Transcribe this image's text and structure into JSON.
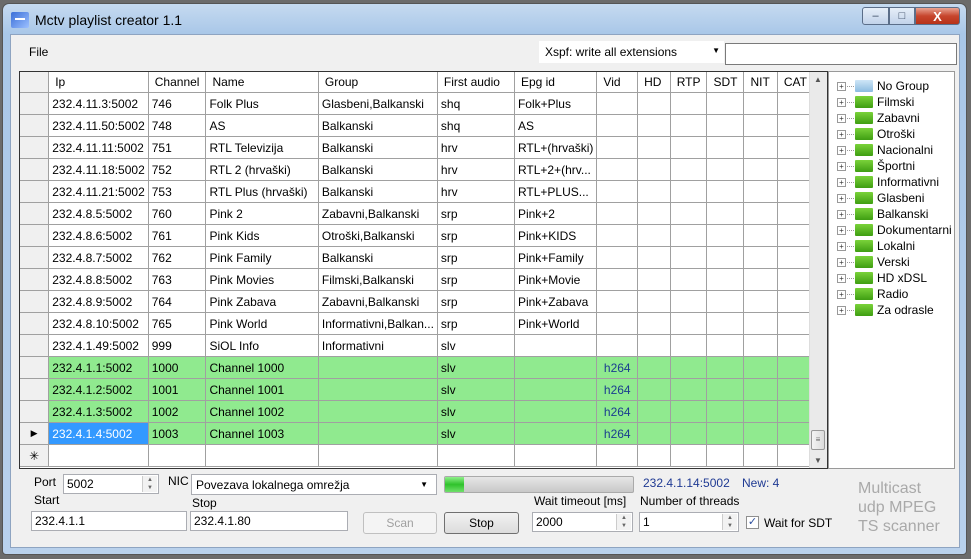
{
  "window": {
    "title": "Mctv playlist creator 1.1",
    "buttons": {
      "minimize": "–",
      "maximize": "□",
      "close": "X"
    }
  },
  "menu": {
    "file": "File"
  },
  "toolbar": {
    "xspf_mode": "Xspf: write all extensions",
    "search_value": ""
  },
  "grid": {
    "columns": [
      "Ip",
      "Channel",
      "Name",
      "Group",
      "First audio",
      "Epg id",
      "Vid",
      "HD",
      "RTP",
      "SDT",
      "NIT",
      "CAT"
    ],
    "rows": [
      {
        "ip": "232.4.11.3:5002",
        "channel": "746",
        "name": "Folk Plus",
        "group": "Glasbeni,Balkanski",
        "audio": "shq",
        "epg": "Folk+Plus",
        "vid": "",
        "new": false
      },
      {
        "ip": "232.4.11.50:5002",
        "channel": "748",
        "name": "AS",
        "group": "Balkanski",
        "audio": "shq",
        "epg": "AS",
        "vid": "",
        "new": false
      },
      {
        "ip": "232.4.11.11:5002",
        "channel": "751",
        "name": "RTL Televizija",
        "group": "Balkanski",
        "audio": "hrv",
        "epg": "RTL+(hrvaški)",
        "vid": "",
        "new": false
      },
      {
        "ip": "232.4.11.18:5002",
        "channel": "752",
        "name": "RTL 2 (hrvaški)",
        "group": "Balkanski",
        "audio": "hrv",
        "epg": "RTL+2+(hrv...",
        "vid": "",
        "new": false
      },
      {
        "ip": "232.4.11.21:5002",
        "channel": "753",
        "name": "RTL Plus (hrvaški)",
        "group": "Balkanski",
        "audio": "hrv",
        "epg": "RTL+PLUS...",
        "vid": "",
        "new": false
      },
      {
        "ip": "232.4.8.5:5002",
        "channel": "760",
        "name": "Pink 2",
        "group": "Zabavni,Balkanski",
        "audio": "srp",
        "epg": "Pink+2",
        "vid": "",
        "new": false
      },
      {
        "ip": "232.4.8.6:5002",
        "channel": "761",
        "name": "Pink Kids",
        "group": "Otroški,Balkanski",
        "audio": "srp",
        "epg": "Pink+KIDS",
        "vid": "",
        "new": false
      },
      {
        "ip": "232.4.8.7:5002",
        "channel": "762",
        "name": "Pink Family",
        "group": "Balkanski",
        "audio": "srp",
        "epg": "Pink+Family",
        "vid": "",
        "new": false
      },
      {
        "ip": "232.4.8.8:5002",
        "channel": "763",
        "name": "Pink Movies",
        "group": "Filmski,Balkanski",
        "audio": "srp",
        "epg": "Pink+Movie",
        "vid": "",
        "new": false
      },
      {
        "ip": "232.4.8.9:5002",
        "channel": "764",
        "name": "Pink Zabava",
        "group": "Zabavni,Balkanski",
        "audio": "srp",
        "epg": "Pink+Zabava",
        "vid": "",
        "new": false
      },
      {
        "ip": "232.4.8.10:5002",
        "channel": "765",
        "name": "Pink World",
        "group": "Informativni,Balkan...",
        "audio": "srp",
        "epg": "Pink+World",
        "vid": "",
        "new": false
      },
      {
        "ip": "232.4.1.49:5002",
        "channel": "999",
        "name": "SiOL Info",
        "group": "Informativni",
        "audio": "slv",
        "epg": "",
        "vid": "",
        "new": false
      },
      {
        "ip": "232.4.1.1:5002",
        "channel": "1000",
        "name": "Channel 1000",
        "group": "",
        "audio": "slv",
        "epg": "",
        "vid": "h264",
        "new": true
      },
      {
        "ip": "232.4.1.2:5002",
        "channel": "1001",
        "name": "Channel 1001",
        "group": "",
        "audio": "slv",
        "epg": "",
        "vid": "h264",
        "new": true
      },
      {
        "ip": "232.4.1.3:5002",
        "channel": "1002",
        "name": "Channel 1002",
        "group": "",
        "audio": "slv",
        "epg": "",
        "vid": "h264",
        "new": true
      },
      {
        "ip": "232.4.1.4:5002",
        "channel": "1003",
        "name": "Channel 1003",
        "group": "",
        "audio": "slv",
        "epg": "",
        "vid": "h264",
        "new": true,
        "selected": true
      }
    ],
    "current_row_marker": "▶",
    "new_row_marker": "✳"
  },
  "tree": {
    "items": [
      "No Group",
      "Filmski",
      "Zabavni",
      "Otroški",
      "Nacionalni",
      "Športni",
      "Informativni",
      "Glasbeni",
      "Balkanski",
      "Dokumentarni",
      "Lokalni",
      "Verski",
      "HD xDSL",
      "Radio",
      "Za odrasle"
    ],
    "expander": "+"
  },
  "scan": {
    "port_label": "Port",
    "port_value": "5002",
    "nic_label": "NIC",
    "nic_value": "Povezava lokalnega omrežja",
    "start_label": "Start",
    "start_value": "232.4.1.1",
    "stop_label": "Stop",
    "stop_value": "232.4.1.80",
    "scan_button": "Scan",
    "stop_button": "Stop",
    "progress": 0.1,
    "current_address": "232.4.1.14:5002",
    "new_count": "New: 4",
    "wait_timeout_label": "Wait timeout [ms]",
    "wait_timeout_value": "2000",
    "threads_label": "Number of threads",
    "threads_value": "1",
    "wait_sdt_label": "Wait for SDT",
    "wait_sdt_checked": true
  },
  "brand": {
    "line1": "Multicast",
    "line2": "udp MPEG",
    "line3": "TS scanner"
  },
  "colors": {
    "new_row": "#90ea8f",
    "selection": "#3399ff",
    "status_text": "#1f3a93"
  }
}
